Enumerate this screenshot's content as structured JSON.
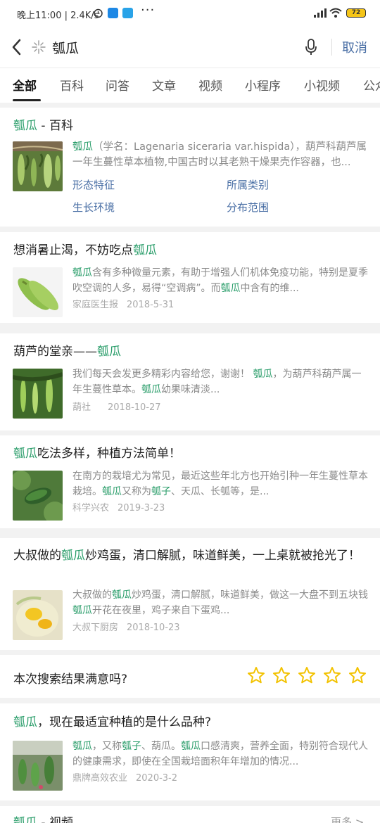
{
  "status_bar": {
    "time": "晚上11:00 | 2.4K/s",
    "dots": "···",
    "battery": "72"
  },
  "search": {
    "query": "瓠瓜",
    "cancel_label": "取消"
  },
  "tabs": [
    "全部",
    "百科",
    "问答",
    "文章",
    "视频",
    "小程序",
    "小视频",
    "公众"
  ],
  "baike": {
    "title_hl": "瓠瓜",
    "title_rest": " - 百科",
    "snippet_hl": "瓠瓜",
    "snippet_rest": "（学名：Lagenaria siceraria var.hispida），葫芦科葫芦属一年生蔓性草本植物,中国古时以其老熟干燥果壳作容器，也...",
    "links": [
      "形态特征",
      "所属类别",
      "生长环境",
      "分布范围"
    ]
  },
  "results": [
    {
      "title_parts": [
        {
          "t": "想消暑止渴，不妨吃点",
          "hl": false
        },
        {
          "t": "瓠瓜",
          "hl": true
        }
      ],
      "snippet_parts": [
        {
          "t": "瓠瓜",
          "hl": true
        },
        {
          "t": "含有多种微量元素，有助于增强人们机体免疫功能，特别是夏季吹空调的人多，易得“空调病”。而",
          "hl": false
        },
        {
          "t": "瓠瓜",
          "hl": true
        },
        {
          "t": "中含有的维...",
          "hl": false
        }
      ],
      "source": "家庭医生报",
      "date": "2018-5-31"
    },
    {
      "title_parts": [
        {
          "t": "葫芦的堂亲——",
          "hl": false
        },
        {
          "t": "瓠瓜",
          "hl": true
        }
      ],
      "snippet_parts": [
        {
          "t": "我们每天会发更多精彩内容给您，谢谢！ ",
          "hl": false
        },
        {
          "t": "瓠瓜",
          "hl": true
        },
        {
          "t": "，为葫芦科葫芦属一年生蔓性草本。",
          "hl": false
        },
        {
          "t": "瓠瓜",
          "hl": true
        },
        {
          "t": "幼果味清淡...",
          "hl": false
        }
      ],
      "source": "葫社",
      "date": "2018-10-27"
    },
    {
      "title_parts": [
        {
          "t": "瓠瓜",
          "hl": true
        },
        {
          "t": "吃法多样，种植方法简单！",
          "hl": false
        }
      ],
      "snippet_parts": [
        {
          "t": "在南方的栽培尤为常见，最近这些年北方也开始引种一年生蔓性草本栽培。",
          "hl": false
        },
        {
          "t": "瓠瓜",
          "hl": true
        },
        {
          "t": "又称为",
          "hl": false
        },
        {
          "t": "瓠子",
          "hl": true
        },
        {
          "t": "、天瓜、长瓠等，是...",
          "hl": false
        }
      ],
      "source": "科学兴农",
      "date": "2019-3-23"
    },
    {
      "title_parts": [
        {
          "t": "大叔做的",
          "hl": false
        },
        {
          "t": "瓠瓜",
          "hl": true
        },
        {
          "t": "炒鸡蛋，清口解腻，味道鲜美，一上桌就被抢光了！",
          "hl": false
        }
      ],
      "snippet_parts": [
        {
          "t": "大叔做的",
          "hl": false
        },
        {
          "t": "瓠瓜",
          "hl": true
        },
        {
          "t": "炒鸡蛋，清口解腻，味道鲜美，做这一大盘不到五块钱",
          "hl": false
        },
        {
          "t": "瓠瓜",
          "hl": true
        },
        {
          "t": "开花在夜里，鸡子来自下蛋鸡...",
          "hl": false
        }
      ],
      "source": "大叔下厨房",
      "date": "2018-10-23"
    },
    {
      "title_parts": [
        {
          "t": "瓠瓜",
          "hl": true
        },
        {
          "t": "，现在最适宜种植的是什么品种?",
          "hl": false
        }
      ],
      "snippet_parts": [
        {
          "t": "瓠瓜",
          "hl": true
        },
        {
          "t": "，又称",
          "hl": false
        },
        {
          "t": "瓠子",
          "hl": true
        },
        {
          "t": "、葫瓜。",
          "hl": false
        },
        {
          "t": "瓠瓜",
          "hl": true
        },
        {
          "t": "口感清爽，营养全面，特别符合现代人的健康需求，即使在全国栽培面积年年增加的情况...",
          "hl": false
        }
      ],
      "source": "鼎牌高效农业",
      "date": "2020-3-2"
    }
  ],
  "survey": {
    "question": "本次搜索结果满意吗?",
    "stars": 5
  },
  "video_section": {
    "title_hl": "瓠瓜",
    "title_rest": " - 视频",
    "more": "更多 >"
  },
  "colors": {
    "highlight": "#2a9d6a",
    "link": "#4a6fa5",
    "star": "#f2c200"
  }
}
